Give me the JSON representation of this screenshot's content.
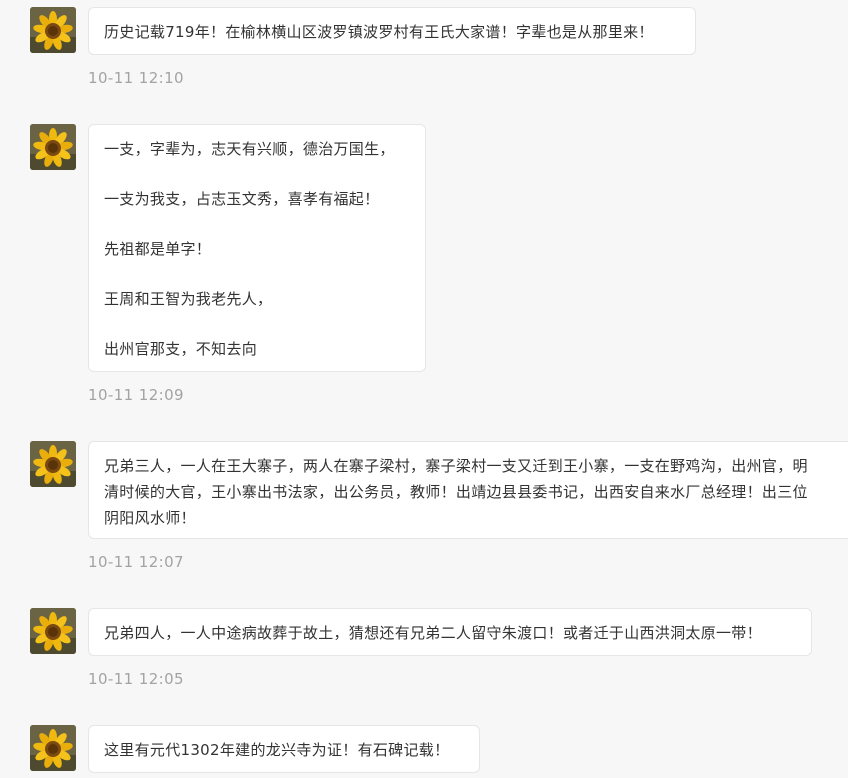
{
  "messages": [
    {
      "avatar_icon": "sunflower-avatar-icon",
      "lines": [
        "历史记载719年！在榆林横山区波罗镇波罗村有王氏大家谱！字辈也是从那里来！"
      ],
      "time": "10-11 12:10"
    },
    {
      "avatar_icon": "sunflower-avatar-icon",
      "lines": [
        "一支，字辈为，志天有兴顺，德治万国生，",
        "一支为我支，占志玉文秀，喜孝有福起！",
        "先祖都是单字！",
        "王周和王智为我老先人，",
        "出州官那支，不知去向"
      ],
      "time": "10-11 12:09"
    },
    {
      "avatar_icon": "sunflower-avatar-icon",
      "lines": [
        "兄弟三人，一人在王大寨子，两人在寨子梁村，寨子梁村一支又迁到王小寨，一支在野鸡沟，出州官，明",
        "清时候的大官，王小寨出书法家，出公务员，教师！出靖边县县委书记，出西安自来水厂总经理！出三位",
        "阴阳风水师！"
      ],
      "time": "10-11 12:07"
    },
    {
      "avatar_icon": "sunflower-avatar-icon",
      "lines": [
        "兄弟四人，一人中途病故葬于故土，猜想还有兄弟二人留守朱渡口！或者迁于山西洪洞太原一带！"
      ],
      "time": "10-11 12:05"
    },
    {
      "avatar_icon": "sunflower-avatar-icon",
      "lines": [
        "这里有元代1302年建的龙兴寺为证！有石碑记载！"
      ],
      "time": ""
    }
  ],
  "colors": {
    "page_background": "#f7f7f7",
    "bubble_background": "#ffffff",
    "bubble_border": "#e6e6e6",
    "message_text": "#333333",
    "timestamp_text": "#a3a3a3"
  }
}
